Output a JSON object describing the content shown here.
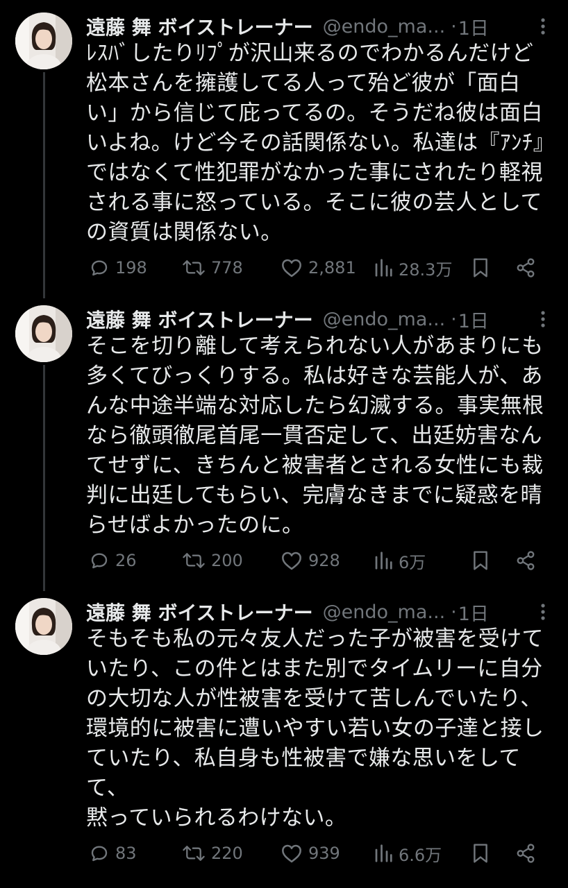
{
  "colors": {
    "background": "#000000",
    "text": "#e7e9ea",
    "muted": "#71767b",
    "thread_line": "#333639"
  },
  "tweets": [
    {
      "author": {
        "name": "遠藤 舞 ボイストレーナー",
        "handle": "@endo_ma...",
        "time": "1日",
        "separator": "·"
      },
      "text": "ﾚｽﾊﾞしたりﾘﾌﾟが沢山来るのでわかるんだけど松本さんを擁護してる人って殆ど彼が「面白い」から信じて庇ってるの。そうだね彼は面白いよね。けど今その話関係ない。私達は『ｱﾝﾁ』ではなくて性犯罪がなかった事にされたり軽視される事に怒っている。そこに彼の芸人としての資質は関係ない。",
      "stats": {
        "replies": "198",
        "reposts": "778",
        "likes": "2,881",
        "views": "28.3万"
      },
      "icons": [
        "reply-icon",
        "repost-icon",
        "like-icon",
        "views-icon",
        "bookmark-icon",
        "share-icon"
      ]
    },
    {
      "author": {
        "name": "遠藤 舞 ボイストレーナー",
        "handle": "@endo_ma...",
        "time": "1日",
        "separator": "·"
      },
      "text": "そこを切り離して考えられない人があまりにも多くてびっくりする。私は好きな芸能人が、あんな中途半端な対応したら幻滅する。事実無根なら徹頭徹尾首尾一貫否定して、出廷妨害なんてせずに、きちんと被害者とされる女性にも裁判に出廷してもらい、完膚なきまでに疑惑を晴らせばよかったのに。",
      "stats": {
        "replies": "26",
        "reposts": "200",
        "likes": "928",
        "views": "6万"
      },
      "icons": [
        "reply-icon",
        "repost-icon",
        "like-icon",
        "views-icon",
        "bookmark-icon",
        "share-icon"
      ]
    },
    {
      "author": {
        "name": "遠藤 舞 ボイストレーナー",
        "handle": "@endo_ma...",
        "time": "1日",
        "separator": "·"
      },
      "text": "そもそも私の元々友人だった子が被害を受けていたり、この件とはまた別でタイムリーに自分の大切な人が性被害を受けて苦しんでいたり、環境的に被害に遭いやすい若い女の子達と接していたり、私自身も性被害で嫌な思いをして\nて、\n黙っていられるわけない。",
      "stats": {
        "replies": "83",
        "reposts": "220",
        "likes": "939",
        "views": "6.6万"
      },
      "icons": [
        "reply-icon",
        "repost-icon",
        "like-icon",
        "views-icon",
        "bookmark-icon",
        "share-icon"
      ]
    }
  ]
}
